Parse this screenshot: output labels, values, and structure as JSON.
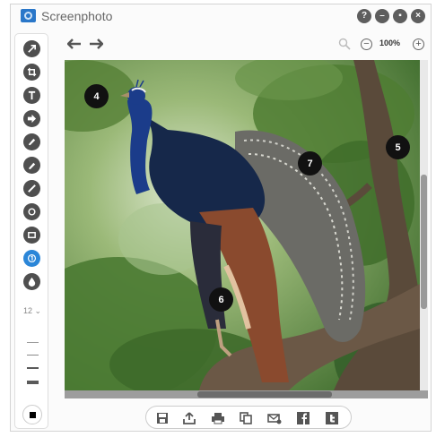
{
  "app": {
    "title": "Screenphoto"
  },
  "window_buttons": [
    {
      "name": "help-button",
      "glyph": "?"
    },
    {
      "name": "minimize-button",
      "glyph": "–"
    },
    {
      "name": "maximize-button",
      "glyph": "▪"
    },
    {
      "name": "close-button",
      "glyph": "×"
    }
  ],
  "tools": [
    "arrow-tool-icon",
    "crop-tool-icon",
    "text-tool-icon",
    "shape-arrow-tool-icon",
    "highlighter-tool-icon",
    "marker-tool-icon",
    "pen-tool-icon",
    "ellipse-tool-icon",
    "rectangle-tool-icon",
    "step-number-tool-icon",
    "blur-tool-icon"
  ],
  "active_tool": "step-number-tool-icon",
  "size": {
    "label": "12 ⌄"
  },
  "zoom": {
    "level": "100%",
    "minus": "−",
    "plus": "+"
  },
  "annotations": [
    {
      "label": "4"
    },
    {
      "label": "5"
    },
    {
      "label": "6"
    },
    {
      "label": "7"
    }
  ],
  "colors": {
    "accent": "#2b86d8",
    "badge": "#111111",
    "current_color": "#000000"
  }
}
